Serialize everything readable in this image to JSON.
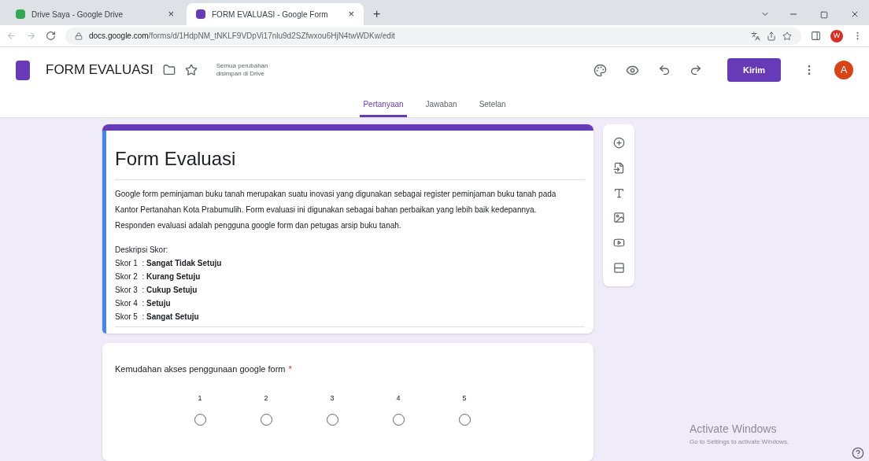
{
  "browser": {
    "tabs": [
      {
        "title": "Drive Saya - Google Drive",
        "selected": false,
        "close": "×"
      },
      {
        "title": "FORM EVALUASI - Google Form",
        "selected": true,
        "close": "×"
      }
    ],
    "new_tab": "+",
    "url_host": "docs.google.com",
    "url_path": "/forms/d/1HdpNM_tNKLF9VDpVi17nlu9d2SZfwxou6HjN4twWDKw/edit",
    "profile": "W"
  },
  "header": {
    "doc_title": "FORM EVALUASI",
    "save_status": "Semua perubahan disimpan di Drive",
    "send_button": "Kirim",
    "avatar": "A"
  },
  "form_tabs": [
    {
      "label": "Pertanyaan",
      "selected": true
    },
    {
      "label": "Jawaban",
      "selected": false
    },
    {
      "label": "Setelan",
      "selected": false
    }
  ],
  "title_card": {
    "title": "Form Evaluasi",
    "description": "Google form peminjaman buku tanah merupakan suatu inovasi yang digunakan sebagai register peminjaman buku tanah pada Kantor Pertanahan Kota Prabumulih. Form evaluasi ini digunakan sebagai bahan perbaikan yang lebih baik kedepannya. Responden evaluasi adalah pengguna google form dan petugas arsip buku tanah.",
    "score_heading": "Deskripsi Skor:",
    "score_lines": [
      "Skor 1  : **Sangat Tidak Setuju**",
      "Skor 2  : **Kurang Setuju**",
      "Skor 3  : **Cukup Setuju**",
      "Skor 4  : **Setuju**",
      "Skor 5  : **Sangat Setuju**"
    ]
  },
  "question": {
    "text": "Kemudahan akses penggunaan google form",
    "required": true,
    "required_mark": "*",
    "scale": [
      {
        "label": "1",
        "selected": false
      },
      {
        "label": "2",
        "selected": false
      },
      {
        "label": "3",
        "selected": false
      },
      {
        "label": "4",
        "selected": false
      },
      {
        "label": "5",
        "selected": false
      }
    ]
  },
  "watermark_os": {
    "title": "Activate Windows",
    "subtitle": "Go to Settings to activate Windows."
  }
}
